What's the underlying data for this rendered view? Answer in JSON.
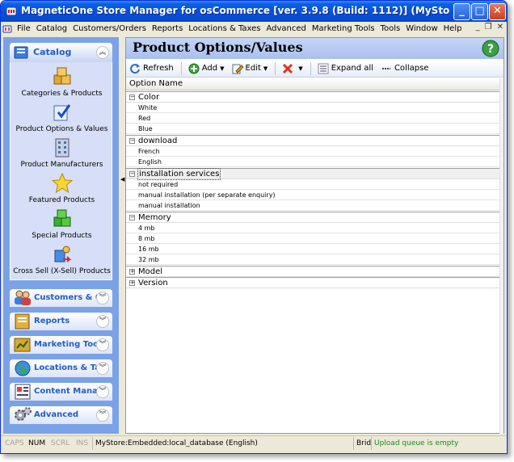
{
  "window": {
    "title": "MagneticOne Store Manager for osCommerce [ver. 3.9.8 (Build: 1112)] (MyStore:Embedded:local_databas...",
    "min_glyph": "_",
    "max_glyph": "□",
    "close_glyph": "✕"
  },
  "menu": {
    "items": [
      "File",
      "Catalog",
      "Customers/Orders",
      "Reports",
      "Locations & Taxes",
      "Advanced",
      "Marketing Tools",
      "Tools",
      "Window",
      "Help"
    ],
    "mdi_min": "_",
    "mdi_restore": "❐",
    "mdi_close": "✕"
  },
  "sidebar": {
    "header": "Catalog",
    "catalog_items": [
      {
        "label": "Categories & Products",
        "icon": "boxes-icon"
      },
      {
        "label": "Product Options & Values",
        "icon": "options-check-icon"
      },
      {
        "label": "Product Manufacturers",
        "icon": "building-icon"
      },
      {
        "label": "Featured Products",
        "icon": "star-icon"
      },
      {
        "label": "Special Products",
        "icon": "green-boxes-icon"
      },
      {
        "label": "Cross Sell (X-Sell) Products",
        "icon": "cross-sell-icon"
      }
    ],
    "sections": [
      {
        "label": "Customers & Or...",
        "icon": "customers-icon"
      },
      {
        "label": "Reports",
        "icon": "reports-icon"
      },
      {
        "label": "Marketing Tools",
        "icon": "marketing-icon"
      },
      {
        "label": "Locations & Ta...",
        "icon": "globe-icon"
      },
      {
        "label": "Content Manager",
        "icon": "content-icon"
      },
      {
        "label": "Advanced",
        "icon": "gears-icon"
      }
    ]
  },
  "main": {
    "title": "Product Options/Values",
    "toolbar": {
      "refresh": "Refresh",
      "add": "Add",
      "edit": "Edit",
      "expand_all": "Expand all",
      "collapse": "Collapse"
    },
    "column_header": "Option Name",
    "groups": [
      {
        "name": "Color",
        "expanded": true,
        "values": [
          "White",
          "Red",
          "Blue"
        ]
      },
      {
        "name": "download",
        "expanded": true,
        "values": [
          "French",
          "English"
        ]
      },
      {
        "name": "installation services",
        "expanded": true,
        "selected": true,
        "values": [
          "not required",
          "manual installation (per separate enquiry)",
          "manual installation"
        ]
      },
      {
        "name": "Memory",
        "expanded": true,
        "values": [
          "4 mb",
          "8 mb",
          "16 mb",
          "32 mb"
        ]
      },
      {
        "name": "Model",
        "expanded": false,
        "values": []
      },
      {
        "name": "Version",
        "expanded": false,
        "values": []
      }
    ]
  },
  "status": {
    "caps": "CAPS",
    "num": "NUM",
    "scrl": "SCRL",
    "ins": "INS",
    "connection": "MyStore:Embedded:local_database (English)",
    "brid": "Brid",
    "queue": "Upload queue is empty"
  },
  "colors": {
    "title_bar": "#0650d8",
    "sidebar_bg": "#7ba2e7",
    "sidebar_body": "#d6dff7",
    "status_green": "#1a8c1a"
  }
}
